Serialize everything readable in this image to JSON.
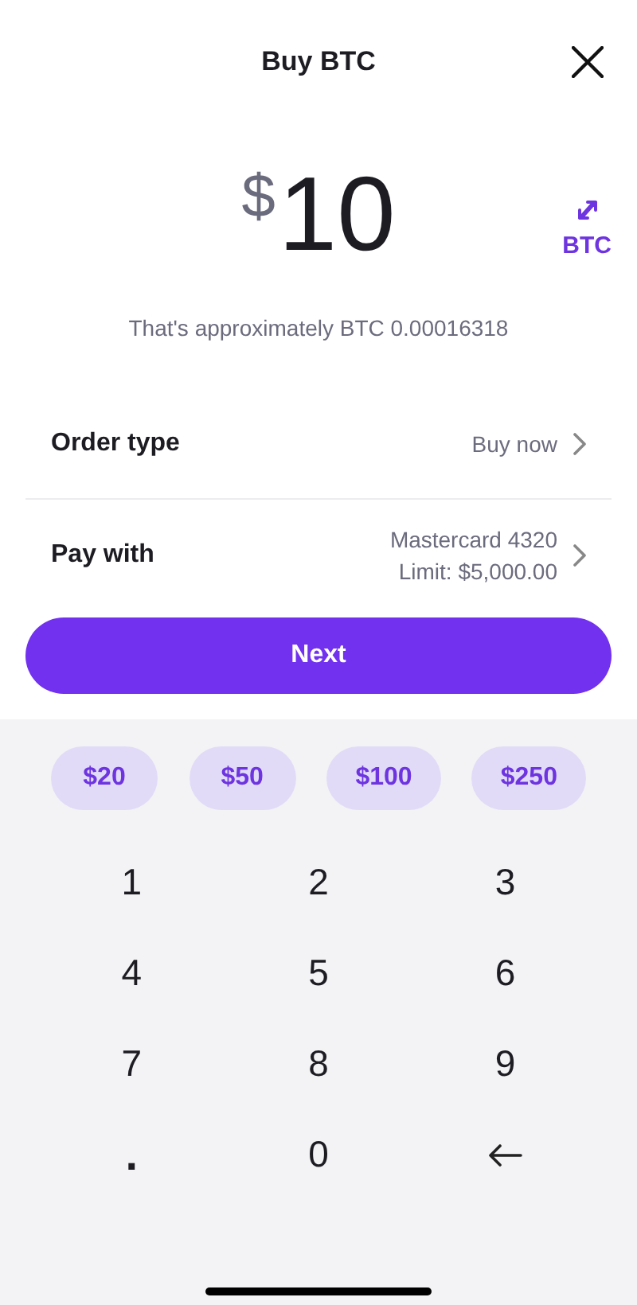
{
  "header": {
    "title": "Buy BTC"
  },
  "amount": {
    "currency_symbol": "$",
    "value": "10",
    "toggle_label": "BTC",
    "approximation": "That's approximately BTC 0.00016318"
  },
  "rows": [
    {
      "label": "Order type",
      "value_lines": [
        "Buy now"
      ]
    },
    {
      "label": "Pay with",
      "value_lines": [
        "Mastercard 4320",
        "Limit: $5,000.00"
      ]
    }
  ],
  "next_button": "Next",
  "presets": [
    "$20",
    "$50",
    "$100",
    "$250"
  ],
  "keypad": [
    {
      "kind": "digit",
      "label": "1"
    },
    {
      "kind": "digit",
      "label": "2"
    },
    {
      "kind": "digit",
      "label": "3"
    },
    {
      "kind": "digit",
      "label": "4"
    },
    {
      "kind": "digit",
      "label": "5"
    },
    {
      "kind": "digit",
      "label": "6"
    },
    {
      "kind": "digit",
      "label": "7"
    },
    {
      "kind": "digit",
      "label": "8"
    },
    {
      "kind": "digit",
      "label": "9"
    },
    {
      "kind": "decimal",
      "label": "."
    },
    {
      "kind": "digit",
      "label": "0"
    },
    {
      "kind": "backspace"
    }
  ]
}
